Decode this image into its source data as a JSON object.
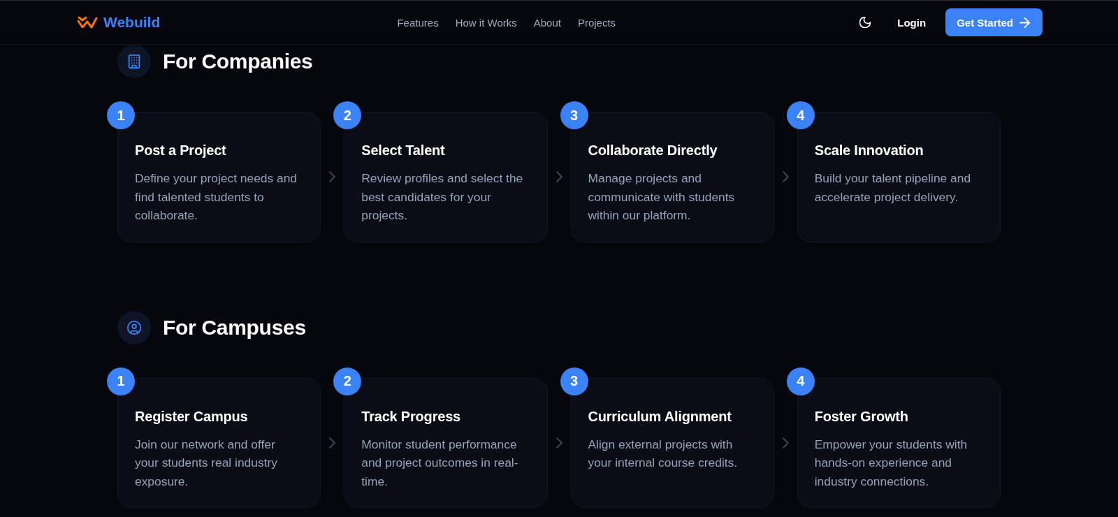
{
  "header": {
    "brand": "Webuild",
    "nav": [
      {
        "label": "Features"
      },
      {
        "label": "How it Works"
      },
      {
        "label": "About"
      },
      {
        "label": "Projects"
      }
    ],
    "login": "Login",
    "cta": "Get Started"
  },
  "sections": [
    {
      "kind": "companies",
      "title": "For Companies",
      "steps": [
        {
          "number": "1",
          "title": "Post a Project",
          "text": "Define your project needs and find talented students to collaborate."
        },
        {
          "number": "2",
          "title": "Select Talent",
          "text": "Review profiles and select the best candidates for your projects."
        },
        {
          "number": "3",
          "title": "Collaborate Directly",
          "text": "Manage projects and communicate with students within our platform."
        },
        {
          "number": "4",
          "title": "Scale Innovation",
          "text": "Build your talent pipeline and accelerate project delivery."
        }
      ]
    },
    {
      "kind": "campuses",
      "title": "For Campuses",
      "steps": [
        {
          "number": "1",
          "title": "Register Campus",
          "text": "Join our network and offer your students real industry exposure."
        },
        {
          "number": "2",
          "title": "Track Progress",
          "text": "Monitor student performance and project outcomes in real-time."
        },
        {
          "number": "3",
          "title": "Curriculum Alignment",
          "text": "Align external projects with your internal course credits."
        },
        {
          "number": "4",
          "title": "Foster Growth",
          "text": "Empower your students with hands-on experience and industry connections."
        }
      ]
    }
  ]
}
